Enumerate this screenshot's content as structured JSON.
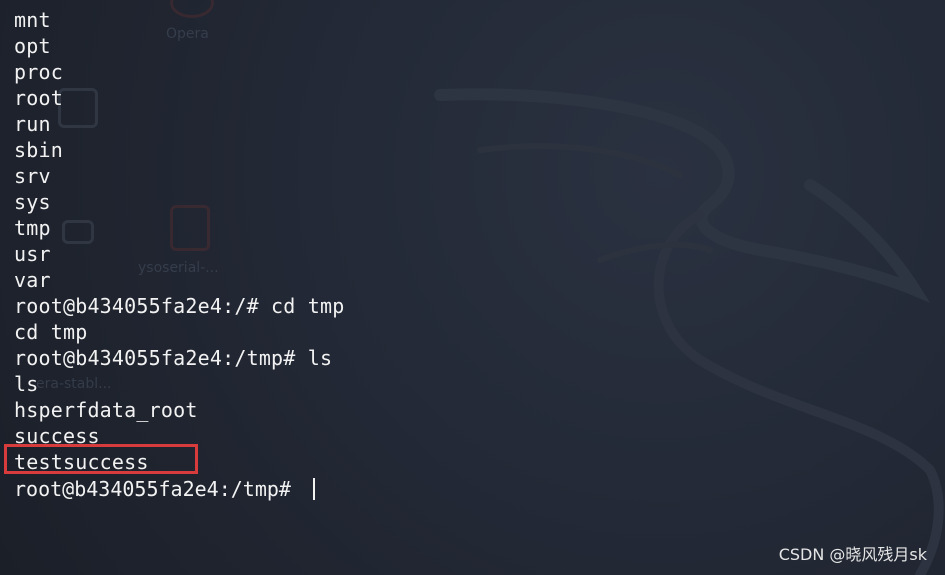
{
  "terminal": {
    "lines": [
      "mnt",
      "opt",
      "proc",
      "root",
      "run",
      "sbin",
      "srv",
      "sys",
      "tmp",
      "usr",
      "var",
      "root@b434055fa2e4:/# cd tmp",
      "cd tmp",
      "root@b434055fa2e4:/tmp# ls",
      "ls",
      "hsperfdata_root",
      "success",
      "testsuccess"
    ],
    "prompt": "root@b434055fa2e4:/tmp# ",
    "highlighted_line": "testsuccess",
    "highlight_color": "#d83b3b"
  },
  "background": {
    "desktop_labels": [
      "Opera",
      "ysoserial-...",
      "era-stabl..."
    ]
  },
  "watermark": "CSDN @晓风残月sk"
}
